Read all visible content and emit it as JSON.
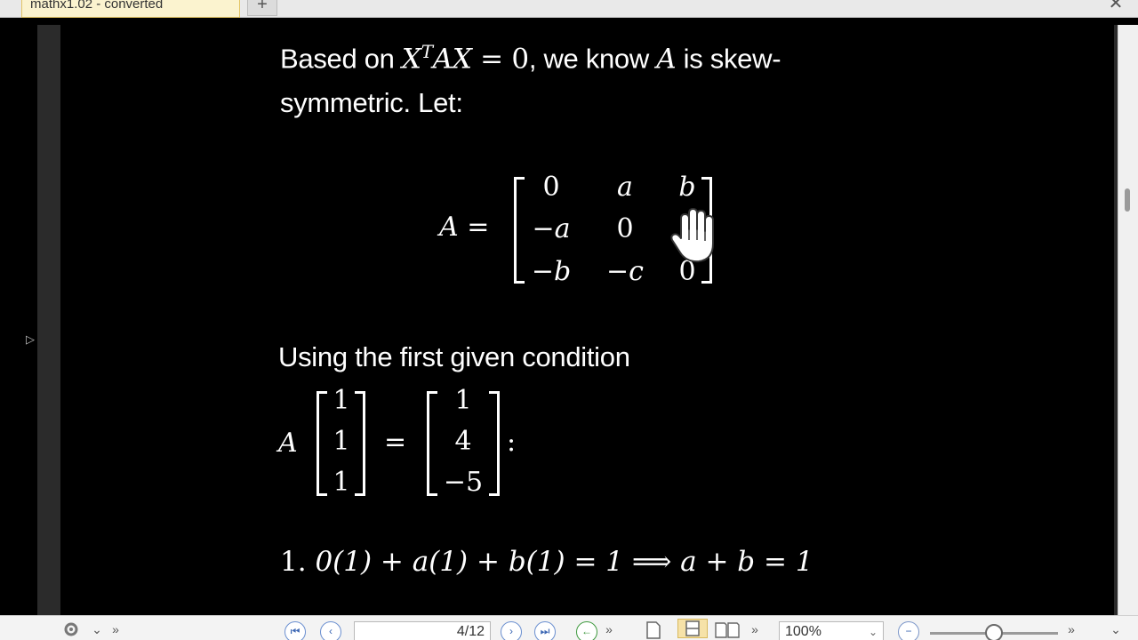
{
  "window": {
    "tab_title": "mathx1.02 - converted",
    "new_tab_label": "+",
    "close_label": "✕",
    "side_panel_toggle": "▷"
  },
  "content": {
    "para1_pre": "Based on ",
    "para1_math_X": "X",
    "para1_math_T": "T",
    "para1_math_AX": "AX",
    "para1_math_eq": " = 0",
    "para1_post": ", we know ",
    "para1_math_A": "A",
    "para1_post2": " is skew-",
    "para1_line2": "symmetric. Let:",
    "matrix_lhs": "A =",
    "matrix": [
      [
        "0",
        "a",
        "b"
      ],
      [
        "−a",
        "0",
        "c"
      ],
      [
        "−b",
        "−c",
        "0"
      ]
    ],
    "para2": "Using the first given condition",
    "cond_A": "A",
    "vec_ones": [
      "1",
      "1",
      "1"
    ],
    "eq_sign": "=",
    "vec_rhs": [
      "1",
      "4",
      "−5"
    ],
    "colon": ":",
    "item1_num": "1. ",
    "item1_eq": "0(1) + a(1) + b(1) = 1 ⟹ a + b = 1"
  },
  "toolbar": {
    "settings_icon": "gear",
    "first_page": "⏮",
    "prev_page": "‹",
    "page_indicator": "4/12",
    "next_page": "›",
    "last_page": "⏭",
    "back": "←",
    "zoom_value": "100%",
    "zoom_out": "−"
  }
}
